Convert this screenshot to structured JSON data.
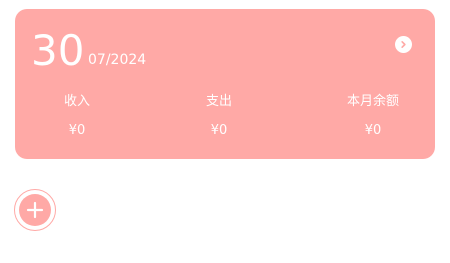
{
  "summary": {
    "day": "30",
    "month_year": "07/2024",
    "income_label": "收入",
    "income_value": "¥0",
    "expense_label": "支出",
    "expense_value": "¥0",
    "balance_label": "本月余额",
    "balance_value": "¥0",
    "next_icon": "chevron-right-icon"
  },
  "actions": {
    "add_icon": "plus-icon"
  },
  "colors": {
    "accent": "#ffa9a6",
    "text_on_accent": "#ffffff"
  }
}
